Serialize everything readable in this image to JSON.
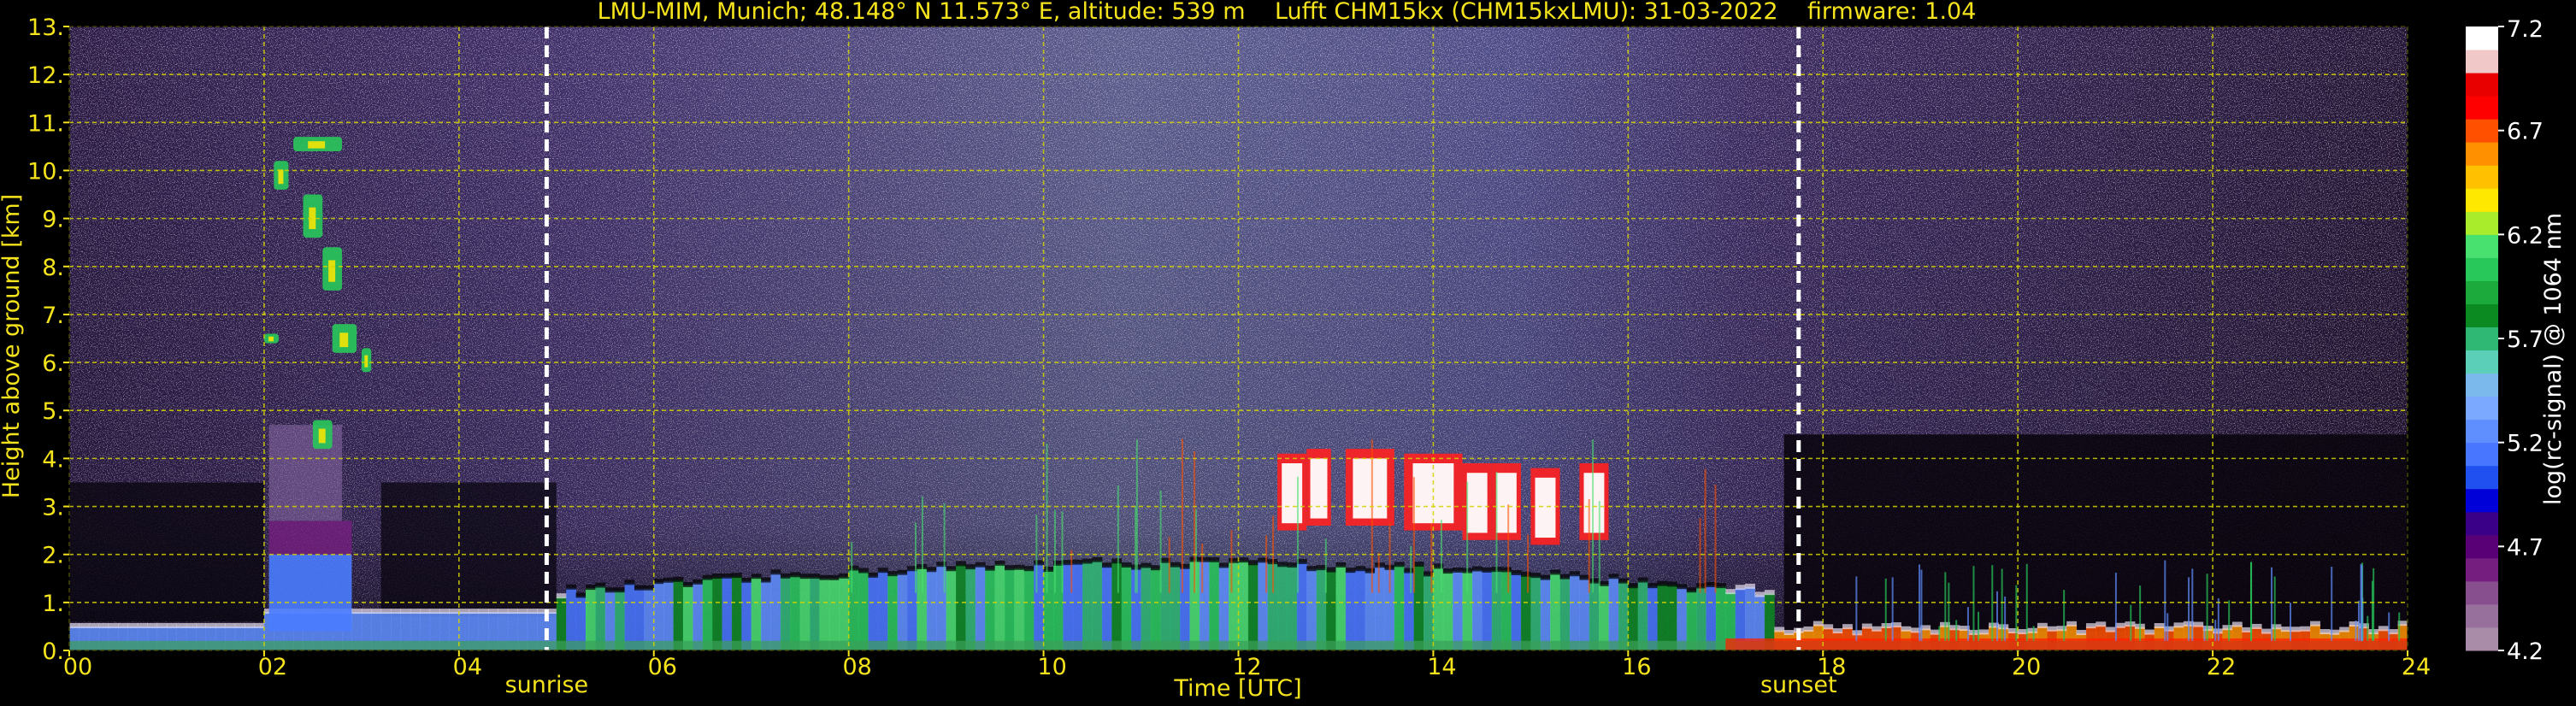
{
  "chart_data": {
    "type": "heatmap",
    "title": "LMU-MIM, Munich; 48.148° N 11.573° E, altitude: 539 m    Lufft CHM15kx (CHM15kxLMU): 31-03-2022    firmware: 1.04",
    "xlabel": "Time [UTC]",
    "ylabel": "Height above ground [km]",
    "xlim": [
      0,
      24
    ],
    "ylim": [
      0,
      13
    ],
    "x_ticks": [
      "00",
      "02",
      "04",
      "06",
      "08",
      "10",
      "12",
      "14",
      "16",
      "18",
      "20",
      "22",
      "24"
    ],
    "y_ticks": [
      "0.",
      "1.",
      "2.",
      "3.",
      "4.",
      "5.",
      "6.",
      "7.",
      "8.",
      "9.",
      "10.",
      "11.",
      "12.",
      "13."
    ],
    "grid": true,
    "colorbar": {
      "label": "log(rc-signal) @ 1064 nm",
      "range": [
        4.2,
        7.2
      ],
      "ticks": [
        "4.2",
        "4.7",
        "5.2",
        "5.7",
        "6.2",
        "6.7",
        "7.2"
      ],
      "colors": [
        "#a88ca8",
        "#98709c",
        "#874f8e",
        "#761e7f",
        "#5a0076",
        "#3a0088",
        "#0000d8",
        "#2050f0",
        "#4876ff",
        "#5f8fff",
        "#7aa9ff",
        "#7bb9ec",
        "#5bcfb8",
        "#2fb874",
        "#0c8a22",
        "#1caa3c",
        "#28c85a",
        "#48e06e",
        "#a8ec2c",
        "#ffe800",
        "#ffc000",
        "#ff9000",
        "#ff5000",
        "#ff0000",
        "#e80000",
        "#f0c8c8",
        "#ffffff"
      ]
    },
    "markers": [
      {
        "label": "sunrise",
        "x": 4.9
      },
      {
        "label": "sunset",
        "x": 17.75
      }
    ]
  }
}
